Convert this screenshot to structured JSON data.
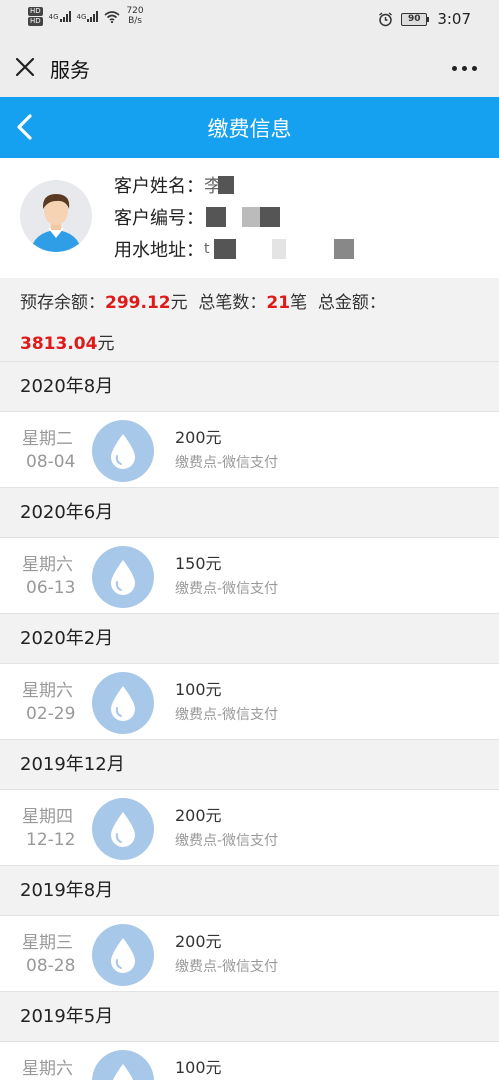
{
  "status_bar": {
    "net1": "4G",
    "net2": "4G",
    "speed": "720",
    "speed_unit": "B/s",
    "battery": "90",
    "time": "3:07"
  },
  "nav": {
    "title": "服务"
  },
  "header": {
    "title": "缴费信息"
  },
  "customer": {
    "name_label": "客户姓名：",
    "name_value": "李",
    "id_label": "客户编号：",
    "address_label": "用水地址：",
    "address_value": "t"
  },
  "summary": {
    "balance_label": "预存余额：",
    "balance_value": "299.12",
    "balance_unit": "元",
    "count_label": "总笔数：",
    "count_value": "21",
    "count_unit": "笔",
    "total_label": "总金额：",
    "total_value": "3813.04",
    "total_unit": "元"
  },
  "groups": [
    {
      "month": "2020年8月",
      "records": [
        {
          "weekday": "星期二",
          "date": "08-04",
          "amount": "200元",
          "method": "缴费点-微信支付"
        }
      ]
    },
    {
      "month": "2020年6月",
      "records": [
        {
          "weekday": "星期六",
          "date": "06-13",
          "amount": "150元",
          "method": "缴费点-微信支付"
        }
      ]
    },
    {
      "month": "2020年2月",
      "records": [
        {
          "weekday": "星期六",
          "date": "02-29",
          "amount": "100元",
          "method": "缴费点-微信支付"
        }
      ]
    },
    {
      "month": "2019年12月",
      "records": [
        {
          "weekday": "星期四",
          "date": "12-12",
          "amount": "200元",
          "method": "缴费点-微信支付"
        }
      ]
    },
    {
      "month": "2019年8月",
      "records": [
        {
          "weekday": "星期三",
          "date": "08-28",
          "amount": "200元",
          "method": "缴费点-微信支付"
        }
      ]
    },
    {
      "month": "2019年5月",
      "records": [
        {
          "weekday": "星期六",
          "date": "",
          "amount": "100元",
          "method": ""
        }
      ]
    }
  ],
  "colors": {
    "header_bg": "#16a0f0",
    "accent_red": "#e01919",
    "drop_circle": "#a8c8ea"
  }
}
